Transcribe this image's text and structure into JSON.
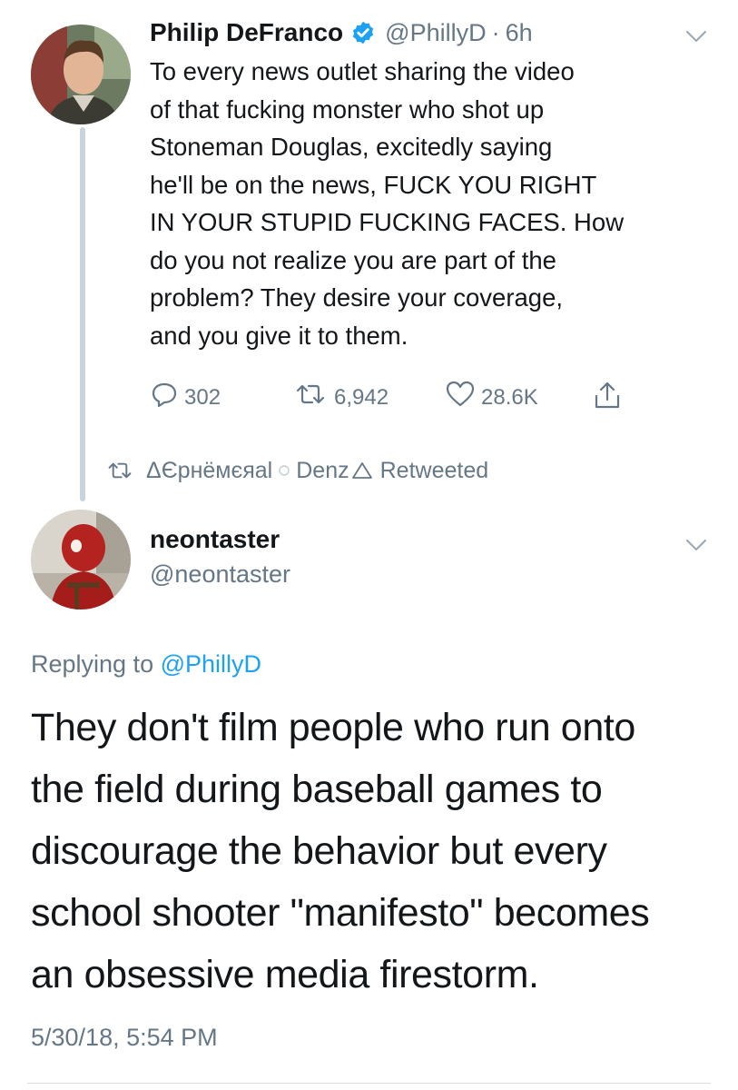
{
  "tweet1": {
    "author_name": "Philip DeFranco",
    "handle": "@PhillyD",
    "separator": "·",
    "time_ago": "6h",
    "verified_icon": "verified-badge-icon",
    "text_lines": [
      "To every news outlet sharing the video",
      "of that fucking monster who shot up",
      "Stoneman Douglas, excitedly saying",
      "he'll be on the news, FUCK YOU RIGHT",
      "IN YOUR STUPID FUCKING FACES. How",
      "do you not realize you are part of the",
      "problem? They desire your coverage,",
      "and you give it to them."
    ],
    "actions": {
      "replies": "302",
      "retweets": "6,942",
      "likes": "28.6K"
    }
  },
  "retweeted_by": {
    "name": "ΔЄрнёмєяal",
    "name2": "Denz",
    "suffix": "Retweeted"
  },
  "tweet2": {
    "author_name": "neontaster",
    "handle": "@neontaster",
    "replying_prefix": "Replying to",
    "replying_handle": "@PhillyD",
    "text_lines": [
      "They don't film people who run onto",
      "the field during baseball games to",
      "discourage the behavior but every",
      "school shooter \"manifesto\" becomes",
      "an obsessive media firestorm."
    ],
    "timestamp": "5/30/18, 5:54 PM"
  },
  "colors": {
    "accent": "#1da1f2",
    "text": "#14171a",
    "muted": "#657786"
  }
}
